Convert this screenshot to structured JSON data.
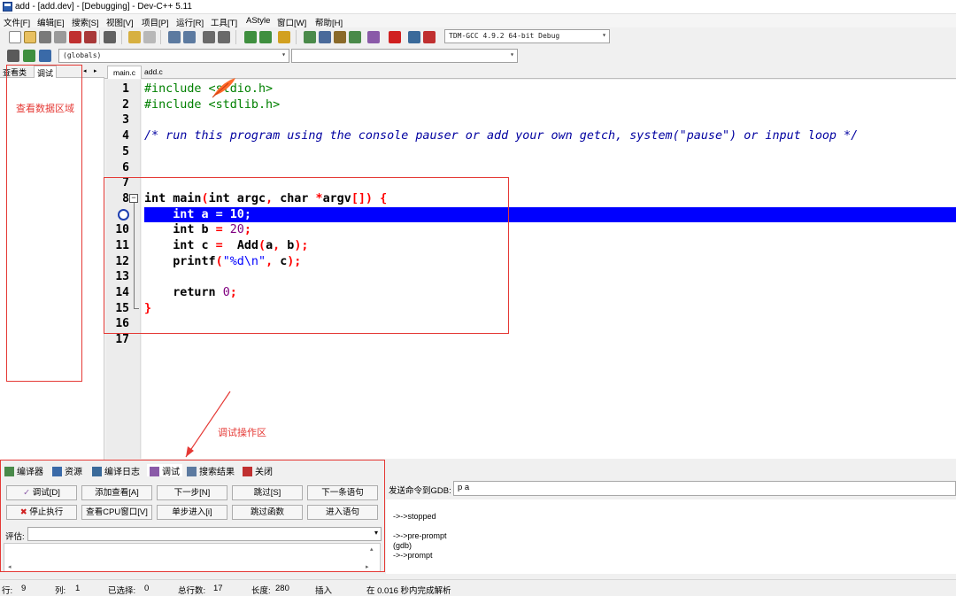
{
  "window": {
    "title": "add - [add.dev] - [Debugging] - Dev-C++ 5.11"
  },
  "menu": [
    "文件[F]",
    "编辑[E]",
    "搜索[S]",
    "视图[V]",
    "项目[P]",
    "运行[R]",
    "工具[T]",
    "AStyle",
    "窗口[W]",
    "帮助[H]"
  ],
  "toolbar": {
    "compiler_select": "TDM-GCC 4.9.2 64-bit Debug",
    "scope_select": "(globals)",
    "symbol_select": ""
  },
  "left_panel": {
    "tabs": [
      "查看类",
      "调试"
    ]
  },
  "editor": {
    "tabs": [
      "main.c",
      "add.c"
    ],
    "lines": [
      "1",
      "2",
      "3",
      "4",
      "5",
      "6",
      "7",
      "8",
      "9",
      "10",
      "11",
      "12",
      "13",
      "14",
      "15",
      "16",
      "17"
    ],
    "current_line": "9"
  },
  "bottom_panel": {
    "tabs": [
      "编译器",
      "资源",
      "编译日志",
      "调试",
      "搜索结果",
      "关闭"
    ],
    "buttons_row1": [
      "调试[D]",
      "添加查看[A]",
      "下一步[N]",
      "跳过[S]",
      "下一条语句"
    ],
    "buttons_row2": [
      "停止执行",
      "查看CPU窗口[V]",
      "单步进入[i]",
      "跳过函数",
      "进入语句"
    ],
    "eval_label": "评估:",
    "gdb_label": "发送命令到GDB:",
    "gdb_input": "p a",
    "gdb_output": [
      "->->stopped",
      "->->pre-prompt",
      "(gdb)",
      "->->prompt"
    ]
  },
  "status": {
    "row_label": "行:",
    "row_value": "9",
    "col_label": "列:",
    "col_value": "1",
    "sel_label": "已选择:",
    "sel_value": "0",
    "total_label": "总行数:",
    "total_value": "17",
    "len_label": "长度:",
    "len_value": "280",
    "mode": "插入",
    "parse": "在 0.016 秒内完成解析"
  },
  "annotations": {
    "watch_area": "查看数据区域",
    "debug_area": "调试操作区"
  },
  "colors": {
    "annotation": "#e53935",
    "current_line_highlight": "#0000ff",
    "preprocessor": "#008000",
    "comment": "#0000a0",
    "number": "#800080",
    "string": "#0000ff",
    "operator": "#ff0000"
  }
}
